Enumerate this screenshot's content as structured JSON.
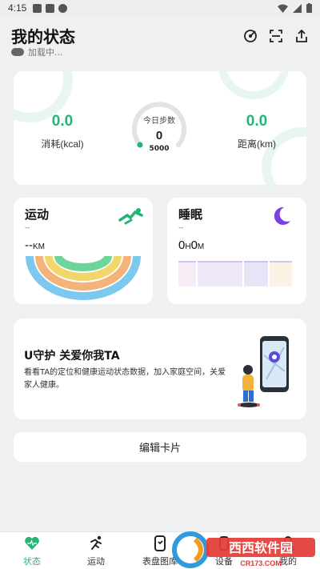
{
  "statusbar": {
    "time": "4:15"
  },
  "header": {
    "title": "我的状态",
    "subtitle": "加载中..."
  },
  "summary": {
    "calories": {
      "value": "0.0",
      "label": "消耗(kcal)"
    },
    "steps": {
      "title": "今日步数",
      "value": "0",
      "goal": "5000"
    },
    "distance": {
      "value": "0.0",
      "label": "距离(km)"
    }
  },
  "exercise": {
    "title": "运动",
    "dash": "--",
    "value": "--",
    "unit": "KM"
  },
  "sleep": {
    "title": "睡眠",
    "dash": "--",
    "h_val": "0",
    "h_unit": "H",
    "m_val": "0",
    "m_unit": "M"
  },
  "promo": {
    "title": "U守护 关爱你我TA",
    "desc": "看看TA的定位和健康运动状态数据，加入家庭空间，关爱家人健康。"
  },
  "edit_card": {
    "label": "编辑卡片"
  },
  "nav": [
    {
      "label": "状态",
      "icon": "heart-icon",
      "active": true
    },
    {
      "label": "运动",
      "icon": "running-icon"
    },
    {
      "label": "表盘图库",
      "icon": "watch-face-icon"
    },
    {
      "label": "设备",
      "icon": "device-icon"
    },
    {
      "label": "我的",
      "icon": "profile-icon"
    }
  ],
  "watermark": {
    "text": "西西软件园",
    "url_text": "CR173.COM"
  },
  "colors": {
    "accent": "#23b574",
    "sleep": "#7b3fe4"
  }
}
